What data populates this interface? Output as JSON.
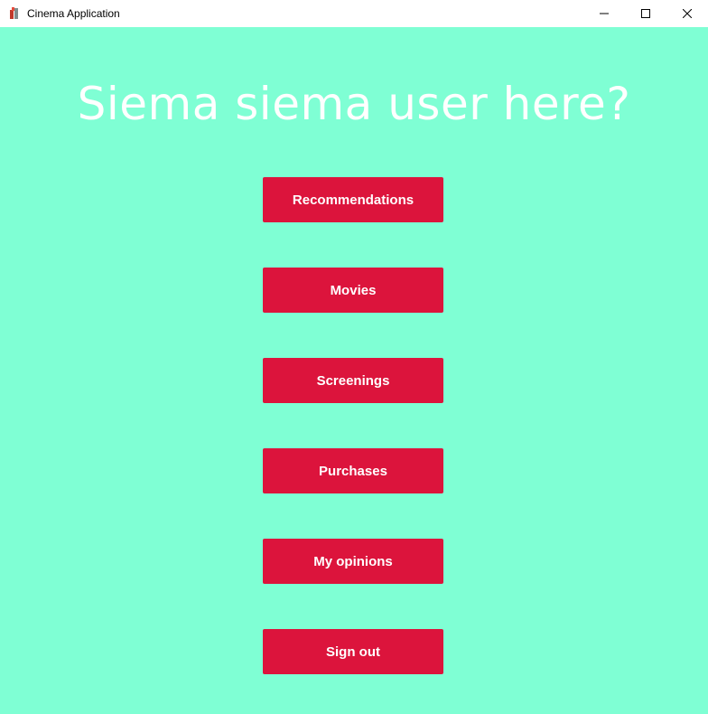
{
  "window": {
    "title": "Cinema Application",
    "icon": "cinema-app-icon",
    "controls": [
      "minimize-icon",
      "maximize-icon",
      "close-icon"
    ]
  },
  "main": {
    "greeting": "Siema siema user here?",
    "buttons": [
      {
        "label": "Recommendations"
      },
      {
        "label": "Movies"
      },
      {
        "label": "Screenings"
      },
      {
        "label": "Purchases"
      },
      {
        "label": "My opinions"
      },
      {
        "label": "Sign out"
      }
    ]
  },
  "colors": {
    "background": "#7fffd4",
    "button": "#dc143c",
    "button_text": "#ffffff",
    "greeting_text": "#ffffff"
  }
}
